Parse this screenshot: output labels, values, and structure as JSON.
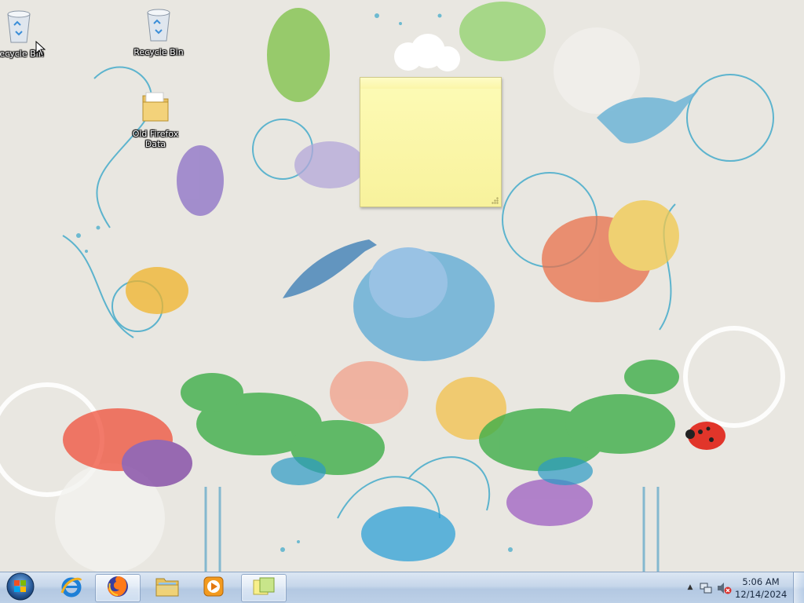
{
  "desktop": {
    "icons": [
      {
        "label": "Recycle Bin",
        "icon": "recycle-bin-icon"
      },
      {
        "label": "Recycle Bin",
        "icon": "recycle-bin-icon"
      },
      {
        "label": "Old Firefox Data",
        "label_line1": "Old Firefox",
        "label_line2": "Data",
        "icon": "folder-icon"
      }
    ],
    "sticky_note": {
      "text": ""
    }
  },
  "taskbar": {
    "start": {
      "icon": "windows-logo-icon"
    },
    "pinned": [
      {
        "name": "Internet Explorer",
        "icon": "internet-explorer-icon",
        "active": false
      },
      {
        "name": "Firefox",
        "icon": "firefox-icon",
        "active": true
      },
      {
        "name": "Windows Explorer",
        "icon": "folder-explorer-icon",
        "active": false
      },
      {
        "name": "Windows Media Player",
        "icon": "media-player-icon",
        "active": false
      },
      {
        "name": "Sticky Notes",
        "icon": "sticky-notes-icon",
        "active": true
      }
    ],
    "tray": {
      "expand_icon": "▲",
      "network_icon": "network-icon",
      "volume_icon": "volume-muted-icon",
      "time": "5:06 AM",
      "date": "12/14/2024"
    }
  },
  "colors": {
    "taskbar": "#c6d6ea",
    "sticky_note": "#fbf6a8",
    "wallpaper_bg": "#e9e7e1"
  }
}
